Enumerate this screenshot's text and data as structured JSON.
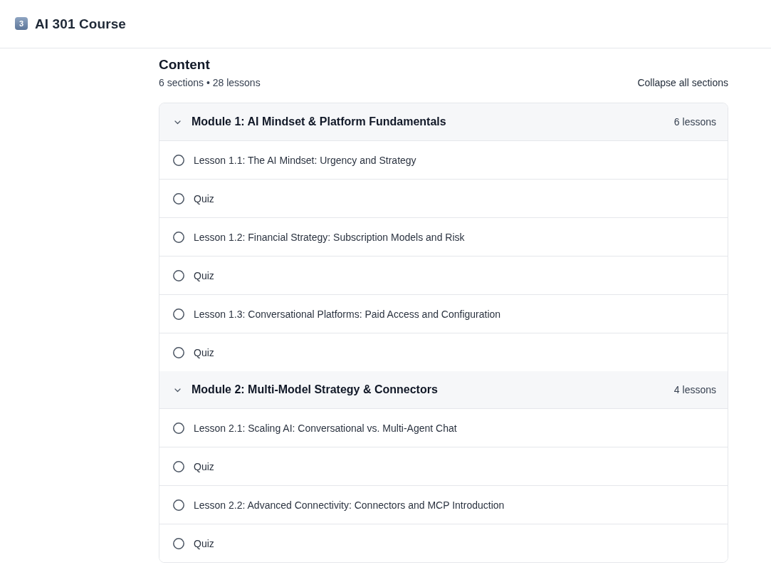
{
  "header": {
    "badge": "3",
    "title": "AI 301 Course"
  },
  "content": {
    "title": "Content",
    "summary": "6 sections • 28 lessons",
    "collapse_link": "Collapse all sections"
  },
  "modules": [
    {
      "title": "Module 1: AI Mindset & Platform Fundamentals",
      "count": "6 lessons",
      "expanded": true,
      "lessons": [
        {
          "title": "Lesson 1.1: The AI Mindset: Urgency and Strategy",
          "completed": false
        },
        {
          "title": "Quiz",
          "completed": false
        },
        {
          "title": "Lesson 1.2: Financial Strategy: Subscription Models and Risk",
          "completed": false
        },
        {
          "title": "Quiz",
          "completed": false
        },
        {
          "title": "Lesson 1.3: Conversational Platforms: Paid Access and Configuration",
          "completed": false
        },
        {
          "title": "Quiz",
          "completed": false
        }
      ]
    },
    {
      "title": "Module 2: Multi-Model Strategy & Connectors",
      "count": "4 lessons",
      "expanded": true,
      "lessons": [
        {
          "title": "Lesson 2.1: Scaling AI: Conversational vs. Multi-Agent Chat",
          "completed": false
        },
        {
          "title": "Quiz",
          "completed": false
        },
        {
          "title": "Lesson 2.2: Advanced Connectivity: Connectors and MCP Introduction",
          "completed": false
        },
        {
          "title": "Quiz",
          "completed": false
        }
      ]
    }
  ]
}
